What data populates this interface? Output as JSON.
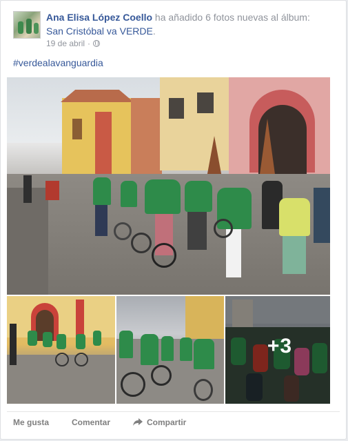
{
  "post": {
    "author_name": "Ana Elisa López Coello",
    "action_text": " ha añadido 6 fotos nuevas al álbum: ",
    "album_name": "San Cristóbal va VERDE",
    "album_suffix": ".",
    "date": "19 de abril",
    "separator": "·",
    "privacy_icon": "globe-icon",
    "hashtag": "#verdealavanguardia"
  },
  "photos": {
    "more_count": "+3"
  },
  "actions": {
    "like_label": "Me gusta",
    "comment_label": "Comentar",
    "share_label": "Compartir",
    "share_icon": "share-arrow-icon"
  },
  "colors": {
    "link": "#365899",
    "secondary_text": "#90949c",
    "action_text": "#7f7f7f",
    "shirt_green": "#2e8b4a"
  }
}
